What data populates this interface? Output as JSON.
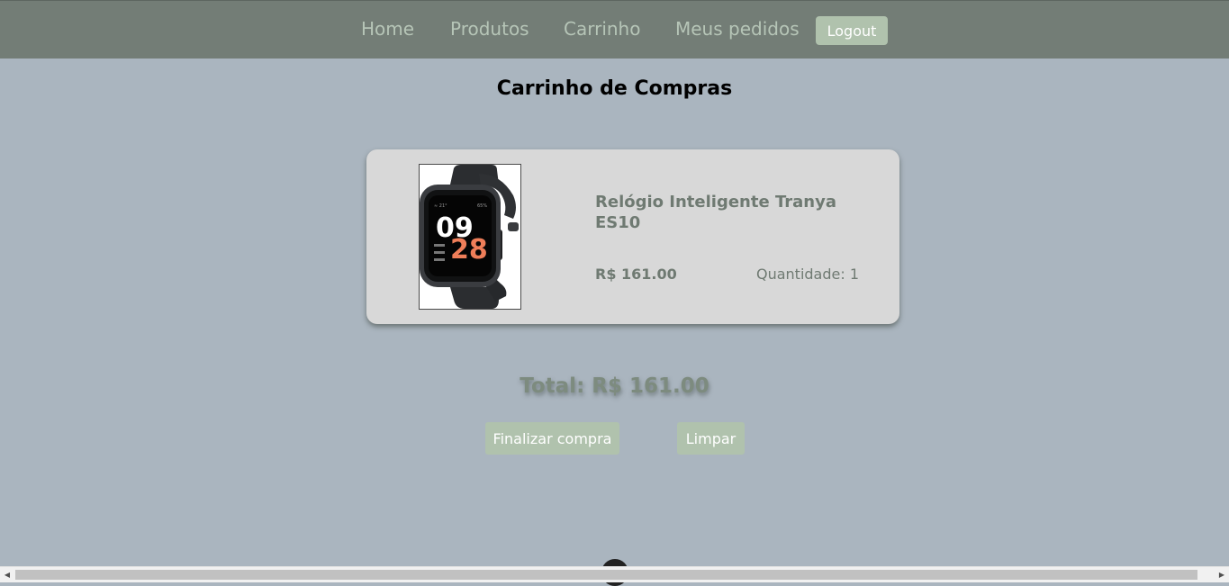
{
  "nav": {
    "links": [
      "Home",
      "Produtos",
      "Carrinho",
      "Meus pedidos"
    ],
    "logout_label": "Logout"
  },
  "page": {
    "title": "Carrinho de Compras"
  },
  "cart": {
    "items": [
      {
        "name": "Relógio Inteligente Tranya ES10",
        "price": "R$ 161.00",
        "quantity_label": "Quantidade: 1",
        "watch_time": {
          "hour": "09",
          "minute": "28"
        }
      }
    ]
  },
  "summary": {
    "total_label": "Total: R$ 161.00",
    "finish_label": "Finalizar compra",
    "clear_label": "Limpar"
  },
  "colors": {
    "background": "#aab5bf",
    "navbar": "#737d76",
    "nav_text": "#b6c5b7",
    "button": "#b0c2ad",
    "card": "#d8d8d8",
    "muted_text": "#6f7a72",
    "watch_accent": "#ef7e59"
  },
  "icons": {
    "scroll_left": "scroll-left-arrow-icon",
    "scroll_right": "scroll-right-arrow-icon"
  }
}
